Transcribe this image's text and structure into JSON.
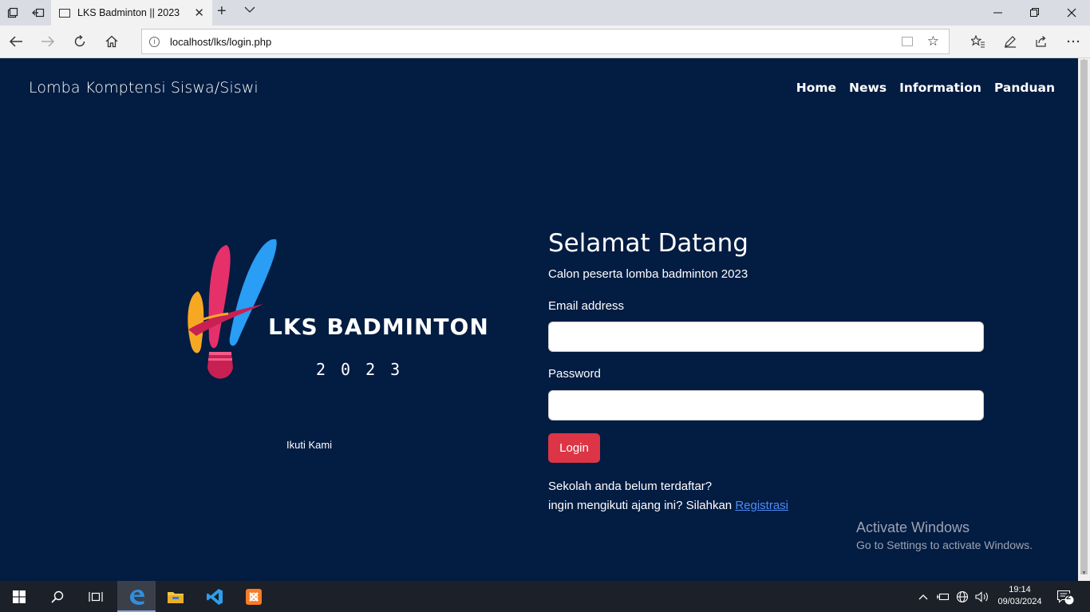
{
  "browser": {
    "tab_title": "LKS Badminton || 2023",
    "url": "localhost/lks/login.php"
  },
  "site": {
    "brand": "Lomba Komptensi Siswa/Siswi",
    "nav": [
      "Home",
      "News",
      "Information",
      "Panduan"
    ]
  },
  "logo": {
    "title": "LKS BADMINTON",
    "year": "2023",
    "colors": [
      "#f7a823",
      "#e5306a",
      "#2a9df4",
      "#c82052"
    ]
  },
  "follow_label": "Ikuti Kami",
  "login": {
    "heading": "Selamat Datang",
    "subtitle": "Calon peserta lomba badminton 2023",
    "email_label": "Email address",
    "email_value": "",
    "password_label": "Password",
    "password_value": "",
    "button": "Login",
    "register_line1": "Sekolah anda belum terdaftar?",
    "register_line2": "ingin mengikuti ajang ini? Silahkan",
    "register_link": "Registrasi"
  },
  "watermark": {
    "line1": "Activate Windows",
    "line2": "Go to Settings to activate Windows."
  },
  "taskbar": {
    "time": "19:14",
    "date": "09/03/2024",
    "notification_count": "2"
  },
  "colors": {
    "page_bg": "#031c42",
    "login_button": "#dc3545",
    "link": "#4d8cf5"
  }
}
